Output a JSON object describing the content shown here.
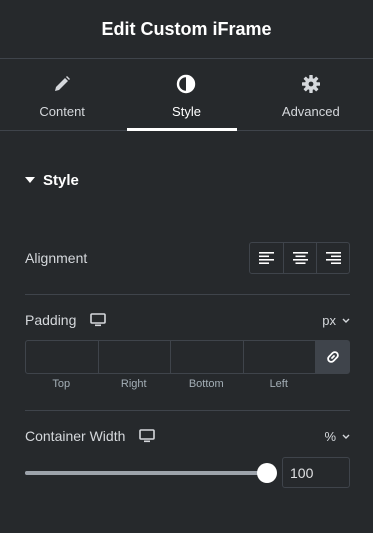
{
  "header": {
    "title": "Edit Custom iFrame"
  },
  "tabs": [
    {
      "label": "Content",
      "icon": "pencil-icon",
      "active": false
    },
    {
      "label": "Style",
      "icon": "half-circle-icon",
      "active": true
    },
    {
      "label": "Advanced",
      "icon": "gear-icon",
      "active": false
    }
  ],
  "section": {
    "title": "Style",
    "icon": "caret-down-icon"
  },
  "alignment": {
    "label": "Alignment",
    "options": [
      {
        "name": "align-left",
        "icon": "align-left-icon"
      },
      {
        "name": "align-center",
        "icon": "align-center-icon"
      },
      {
        "name": "align-right",
        "icon": "align-right-icon"
      }
    ]
  },
  "padding": {
    "label": "Padding",
    "device_icon": "desktop-icon",
    "unit": "px",
    "fields": [
      {
        "label": "Top",
        "value": ""
      },
      {
        "label": "Right",
        "value": ""
      },
      {
        "label": "Bottom",
        "value": ""
      },
      {
        "label": "Left",
        "value": ""
      }
    ],
    "link_icon": "link-icon"
  },
  "container_width": {
    "label": "Container Width",
    "device_icon": "desktop-icon",
    "unit": "%",
    "value": "100",
    "slider_fraction": 1.0
  },
  "colors": {
    "background": "#26292c",
    "border": "#3f444b",
    "text": "#d5d8dc",
    "active": "#ffffff"
  }
}
